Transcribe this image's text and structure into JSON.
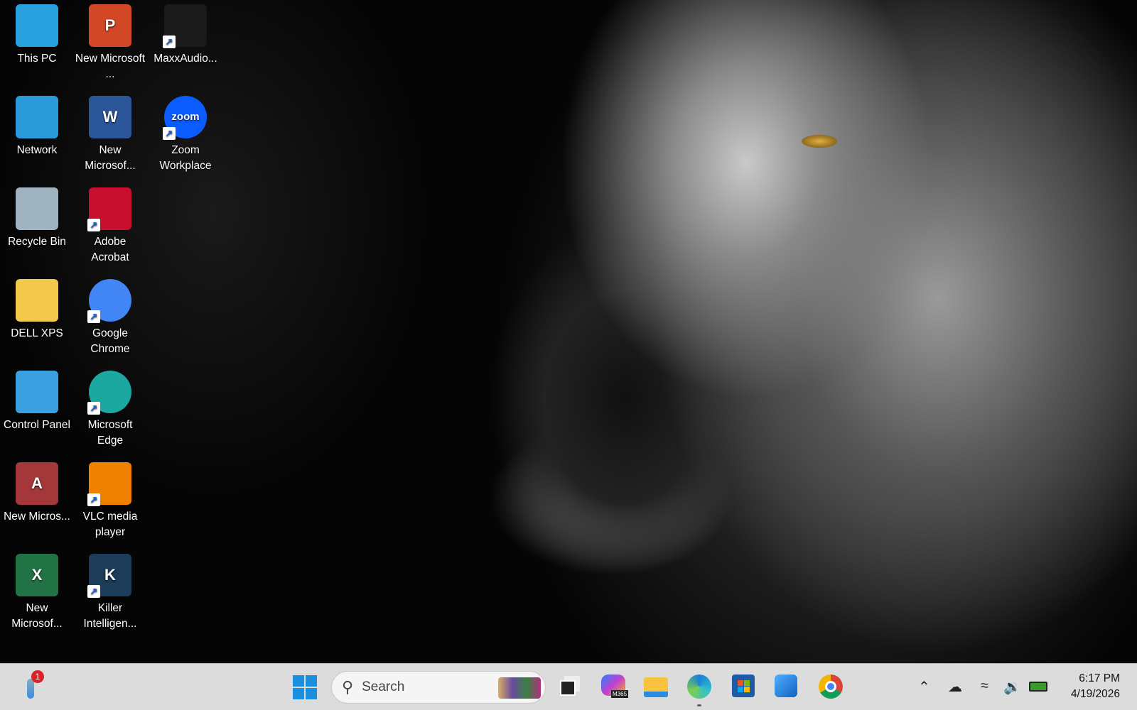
{
  "desktop_icons": [
    {
      "label": "This PC",
      "icon": "monitor-icon",
      "color": "#29a0e0"
    },
    {
      "label": "New Microsoft ...",
      "icon": "powerpoint-icon",
      "color": "#d24726"
    },
    {
      "label": "MaxxAudio...",
      "icon": "maxxaudio-icon",
      "color": "#1a1a1a"
    },
    {
      "label": "Network",
      "icon": "network-icon",
      "color": "#2a9ad8"
    },
    {
      "label": "New Microsof...",
      "icon": "word-icon",
      "color": "#2b579a"
    },
    {
      "label": "Zoom Workplace",
      "icon": "zoom-icon",
      "color": "#0b5cff"
    },
    {
      "label": "Recycle Bin",
      "icon": "recycle-bin-icon",
      "color": "#9fb3c0"
    },
    {
      "label": "Adobe Acrobat",
      "icon": "acrobat-icon",
      "color": "#c8102e"
    },
    {
      "label": "DELL XPS",
      "icon": "folder-icon",
      "color": "#f2c94c"
    },
    {
      "label": "Google Chrome",
      "icon": "chrome-icon",
      "color": "#4285f4"
    },
    {
      "label": "Control Panel",
      "icon": "control-panel-icon",
      "color": "#3aa0e0"
    },
    {
      "label": "Microsoft Edge",
      "icon": "edge-icon",
      "color": "#1aa8a0"
    },
    {
      "label": "New Micros...",
      "icon": "access-icon",
      "color": "#a4373a"
    },
    {
      "label": "VLC media player",
      "icon": "vlc-icon",
      "color": "#f08000"
    },
    {
      "label": "New Microsof...",
      "icon": "excel-icon",
      "color": "#217346"
    },
    {
      "label": "Killer Intelligen...",
      "icon": "killer-icon",
      "color": "#1c3c5a"
    }
  ],
  "icon_glyphs": {
    "powerpoint": "P",
    "word": "W",
    "zoom": "zoom",
    "access": "A",
    "excel": "X",
    "killer": "K"
  },
  "taskbar": {
    "weather_badge": "1",
    "search_placeholder": "Search",
    "m365_badge": "M365",
    "time": "6:17 PM",
    "date": "4/19/2026"
  }
}
